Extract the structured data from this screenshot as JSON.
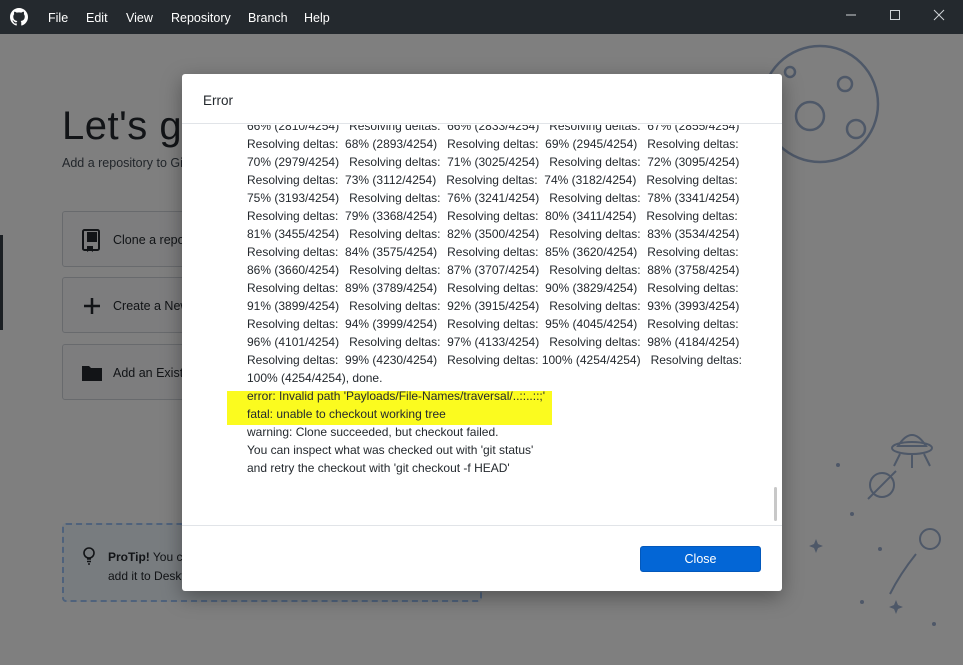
{
  "menu": {
    "items": [
      "File",
      "Edit",
      "View",
      "Repository",
      "Branch",
      "Help"
    ]
  },
  "window_controls": {
    "icons": [
      "minimize-icon",
      "maximize-icon",
      "close-icon"
    ]
  },
  "welcome": {
    "title": "Let's ge",
    "subtitle": "Add a repository to Git",
    "buttons": [
      {
        "label": "Clone a repos",
        "icon": "clone-book-icon"
      },
      {
        "label": "Create a New",
        "icon": "plus-icon"
      },
      {
        "label": "Add an Existin",
        "icon": "folder-icon"
      }
    ],
    "protip": {
      "strong": "ProTip!",
      "line1_rest": " You ca",
      "line2": "add it to Deskt"
    }
  },
  "dialog": {
    "title": "Error",
    "log_lines": [
      "66% (2810/4254)   Resolving deltas:  66% (2833/4254)   Resolving deltas:  67% (2855/4254)",
      "Resolving deltas:  68% (2893/4254)   Resolving deltas:  69% (2945/4254)   Resolving deltas:",
      "70% (2979/4254)   Resolving deltas:  71% (3025/4254)   Resolving deltas:  72% (3095/4254)",
      "Resolving deltas:  73% (3112/4254)   Resolving deltas:  74% (3182/4254)   Resolving deltas:",
      "75% (3193/4254)   Resolving deltas:  76% (3241/4254)   Resolving deltas:  78% (3341/4254)",
      "Resolving deltas:  79% (3368/4254)   Resolving deltas:  80% (3411/4254)   Resolving deltas:",
      "81% (3455/4254)   Resolving deltas:  82% (3500/4254)   Resolving deltas:  83% (3534/4254)",
      "Resolving deltas:  84% (3575/4254)   Resolving deltas:  85% (3620/4254)   Resolving deltas:",
      "86% (3660/4254)   Resolving deltas:  87% (3707/4254)   Resolving deltas:  88% (3758/4254)",
      "Resolving deltas:  89% (3789/4254)   Resolving deltas:  90% (3829/4254)   Resolving deltas:",
      "91% (3899/4254)   Resolving deltas:  92% (3915/4254)   Resolving deltas:  93% (3993/4254)",
      "Resolving deltas:  94% (3999/4254)   Resolving deltas:  95% (4045/4254)   Resolving deltas:",
      "96% (4101/4254)   Resolving deltas:  97% (4133/4254)   Resolving deltas:  98% (4184/4254)",
      "Resolving deltas:  99% (4230/4254)   Resolving deltas: 100% (4254/4254)   Resolving deltas:",
      "100% (4254/4254), done.",
      "error: Invalid path 'Payloads/File-Names/traversal/..::..::;'",
      "fatal: unable to checkout working tree",
      "warning: Clone succeeded, but checkout failed.",
      "You can inspect what was checked out with 'git status'",
      "and retry the checkout with 'git checkout -f HEAD'"
    ],
    "close_label": "Close"
  },
  "colors": {
    "titlebar": "#24292e",
    "accent": "#0366d6",
    "highlight": "#fbfb1f"
  }
}
